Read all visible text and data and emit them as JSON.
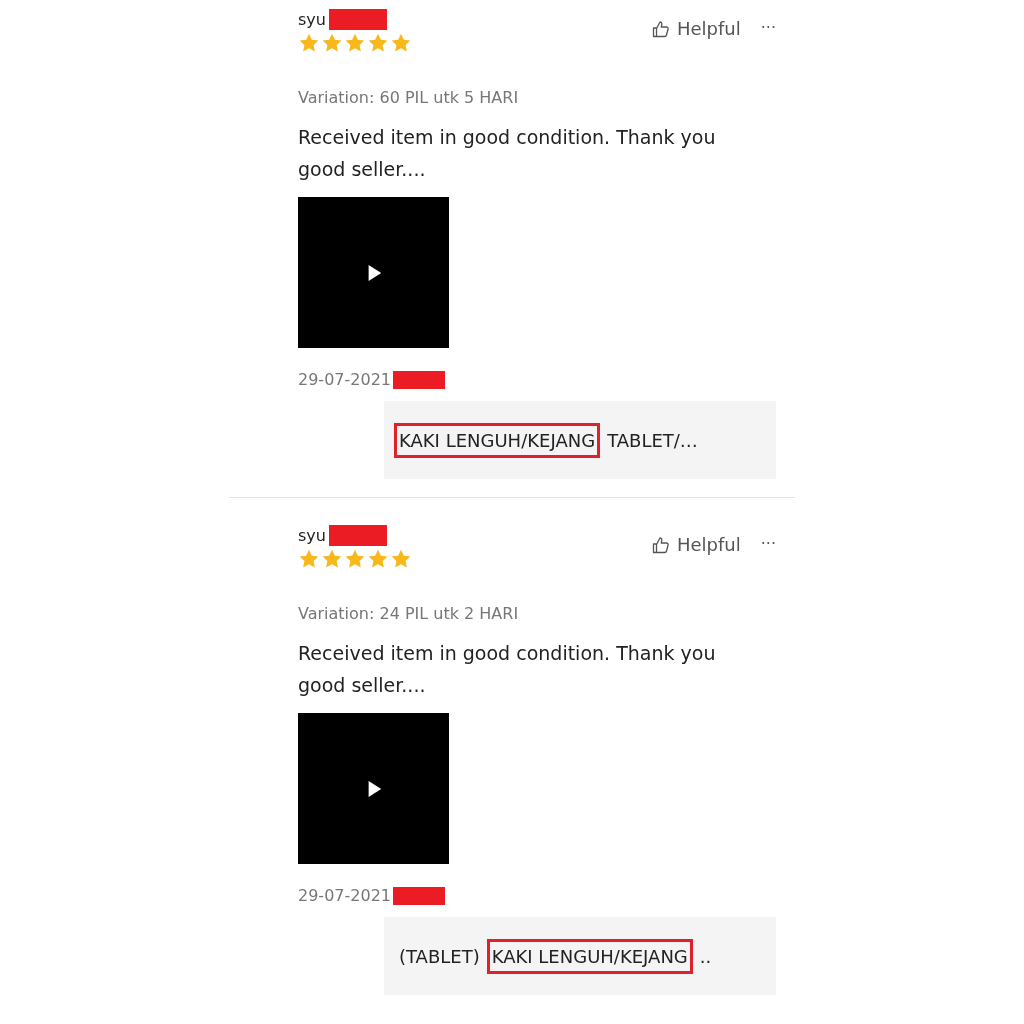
{
  "reviews": [
    {
      "username": "syu",
      "stars": 5,
      "helpful": "Helpful",
      "more": "···",
      "variation": "Variation: 60 PIL utk 5 HARI",
      "text": "Received item in good condition. Thank you good seller....",
      "media": {
        "kind": "video"
      },
      "date": "29-07-2021",
      "product": [
        {
          "text": "KAKI LENGUH/KEJANG",
          "highlighted": true
        },
        {
          "text": "TABLET/…",
          "highlighted": false
        }
      ]
    },
    {
      "username": "syu",
      "stars": 5,
      "helpful": "Helpful",
      "more": "···",
      "variation": "Variation: 24 PIL utk 2 HARI",
      "text": "Received item in good condition. Thank you good seller....",
      "media": {
        "kind": "video"
      },
      "date": "29-07-2021",
      "product": [
        {
          "text": "(TABLET)",
          "highlighted": false
        },
        {
          "text": "KAKI LENGUH/KEJANG",
          "highlighted": true
        },
        {
          "text": "..",
          "highlighted": false
        }
      ]
    }
  ]
}
